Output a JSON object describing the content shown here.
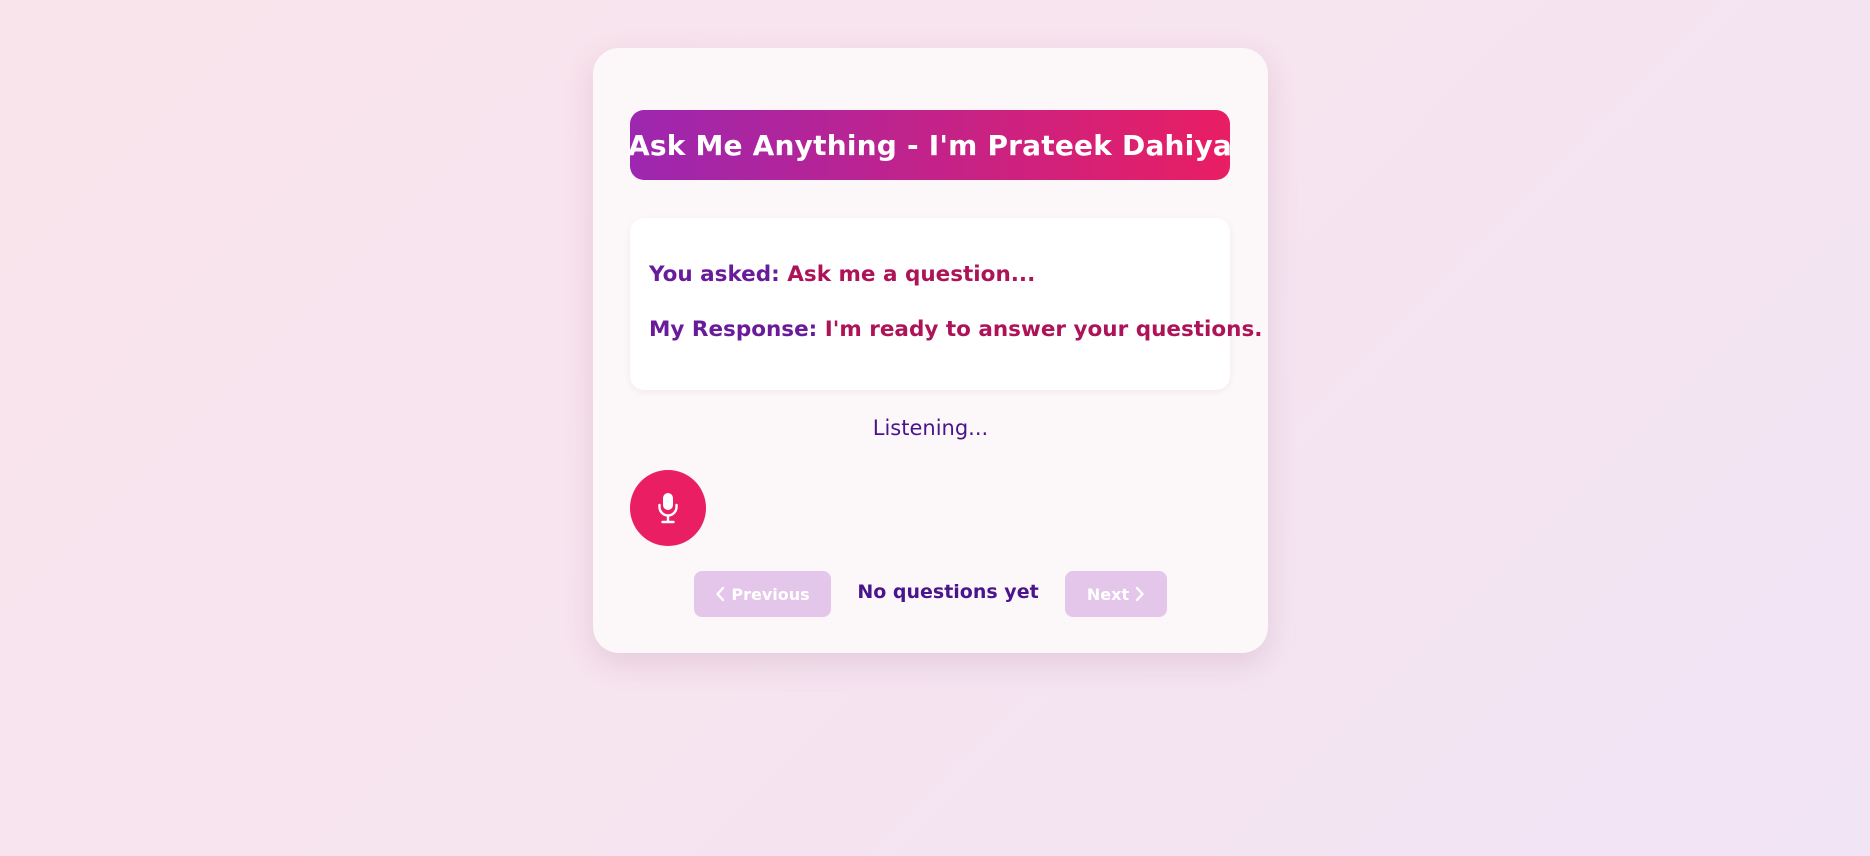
{
  "header": {
    "title": "Ask Me Anything - I'm Prateek Dahiya"
  },
  "conversation": {
    "question_label": "You asked:",
    "question_text": "Ask me a question...",
    "response_label": "My Response:",
    "response_text": "I'm ready to answer your questions."
  },
  "status": {
    "text": "Listening..."
  },
  "mic": {
    "icon": "microphone-icon"
  },
  "navigation": {
    "previous_label": "Previous",
    "next_label": "Next",
    "counter_text": "No questions yet",
    "previous_icon": "chevron-left-icon",
    "next_icon": "chevron-right-icon"
  },
  "colors": {
    "gradient_start": "#9c27b0",
    "gradient_end": "#e91e63",
    "label_purple": "#6a1b9a",
    "value_pink": "#ad1457",
    "mic_pink": "#e91e63",
    "disabled_button": "#e3c6ea"
  }
}
